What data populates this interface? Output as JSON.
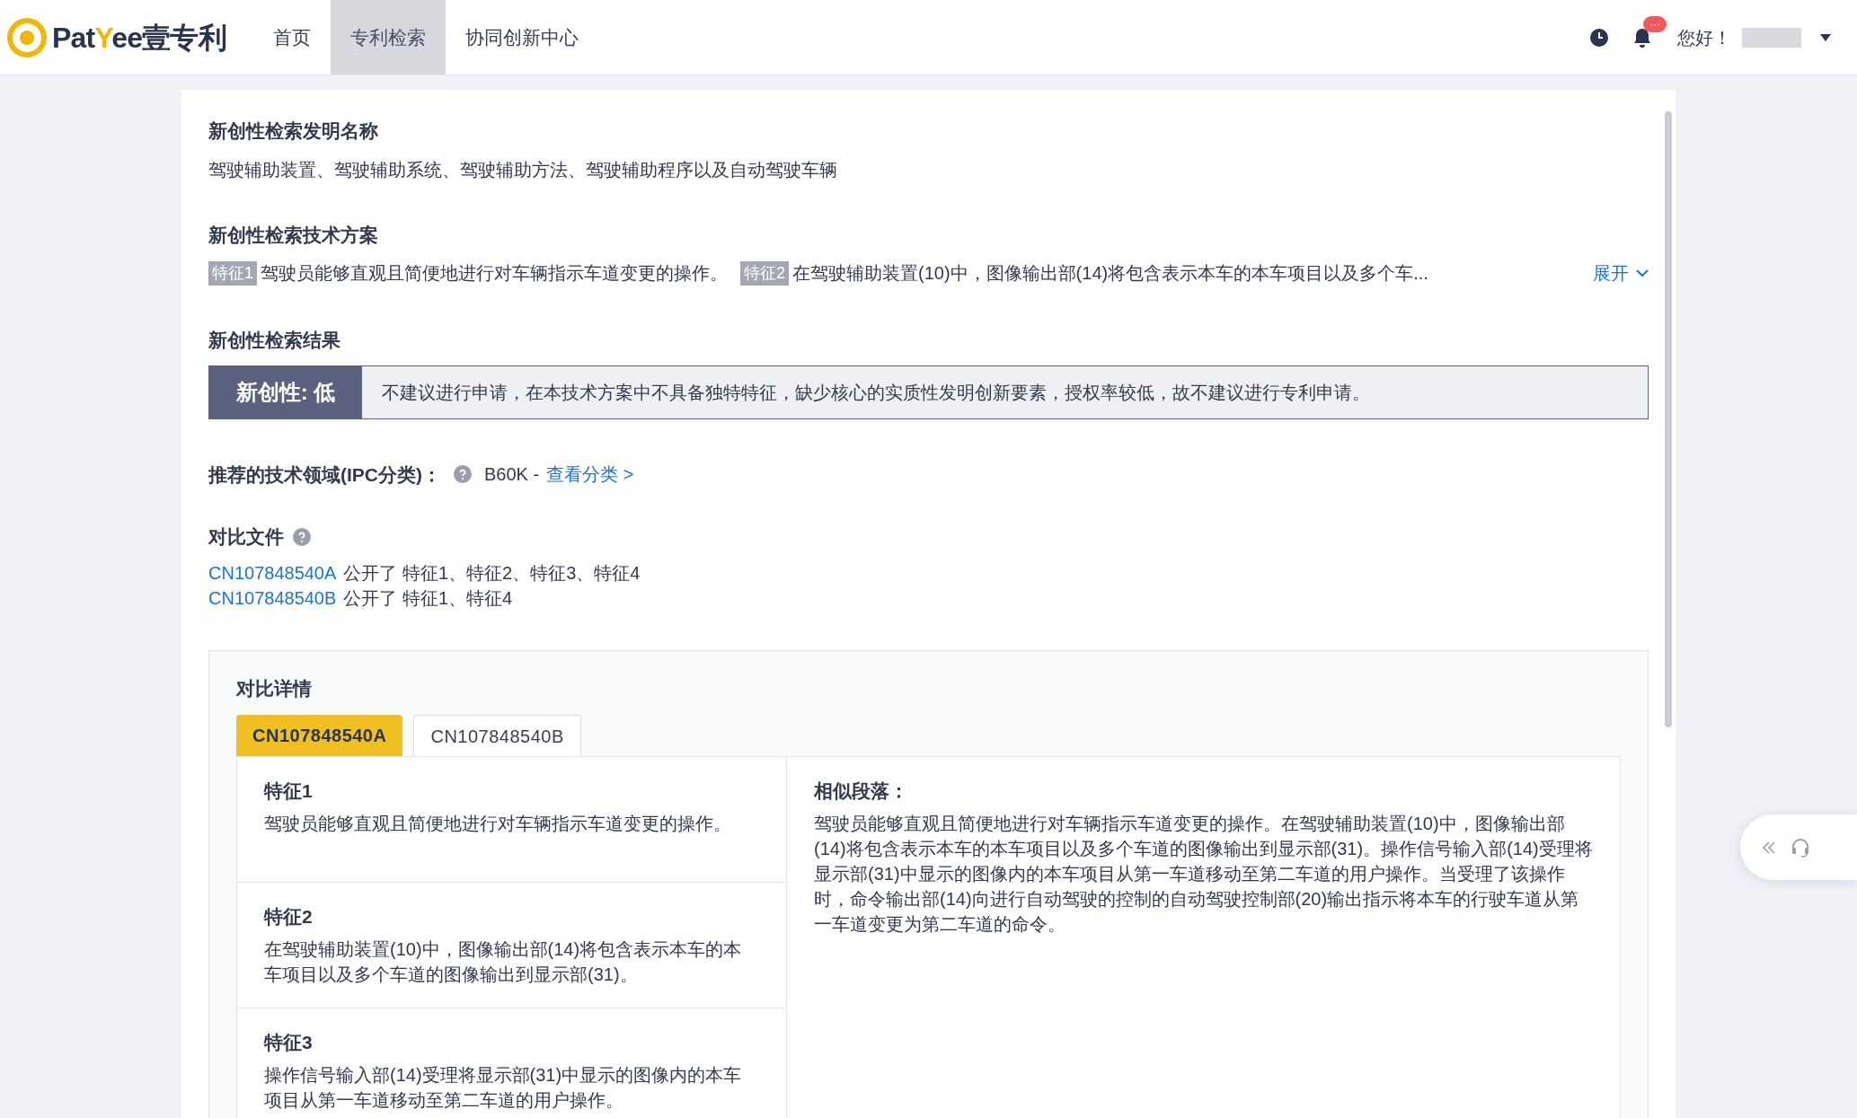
{
  "header": {
    "logo": [
      {
        "text": "Pat",
        "accent": false
      },
      {
        "text": "Y",
        "accent": true
      },
      {
        "text": "ee",
        "accent": false
      },
      {
        "text": "壹专利",
        "accent": false
      }
    ],
    "nav": [
      {
        "label": "首页",
        "selected": false
      },
      {
        "label": "专利检索",
        "selected": true
      },
      {
        "label": "协同创新中心",
        "selected": false
      }
    ],
    "notification_badge": "···",
    "greeting": "您好！"
  },
  "invention_name": {
    "title": "新创性检索发明名称",
    "text": "驾驶辅助装置、驾驶辅助系统、驾驶辅助方法、驾驶辅助程序以及自动驾驶车辆"
  },
  "technical_solution": {
    "title": "新创性检索技术方案",
    "features": [
      {
        "tag": "特征1",
        "text": "驾驶员能够直观且简便地进行对车辆指示车道变更的操作。"
      },
      {
        "tag": "特征2",
        "text": "在驾驶辅助装置(10)中，图像输出部(14)将包含表示本车的本车项目以及多个车..."
      }
    ],
    "expand_link": "展开"
  },
  "result": {
    "title": "新创性检索结果",
    "rating": "新创性: 低",
    "description": "不建议进行申请，在本技术方案中不具备独特特征，缺少核心的实质性发明创新要素，授权率较低，故不建议进行专利申请。"
  },
  "ipc": {
    "label": "推荐的技术领域(IPC分类)：",
    "code": "B60K -",
    "link": "查看分类 >"
  },
  "reference_documents": {
    "title": "对比文件",
    "items": [
      {
        "id": "CN107848540A",
        "text": "公开了 特征1、特征2、特征3、特征4"
      },
      {
        "id": "CN107848540B",
        "text": "公开了 特征1、特征4"
      }
    ]
  },
  "comparison": {
    "title": "对比详情",
    "tabs": [
      {
        "label": "CN107848540A",
        "selected": true
      },
      {
        "label": "CN107848540B",
        "selected": false
      }
    ],
    "features": [
      {
        "title": "特征1",
        "text": "驾驶员能够直观且简便地进行对车辆指示车道变更的操作。"
      },
      {
        "title": "特征2",
        "text": "在驾驶辅助装置(10)中，图像输出部(14)将包含表示本车的本车项目以及多个车道的图像输出到显示部(31)。"
      },
      {
        "title": "特征3",
        "text": "操作信号输入部(14)受理将显示部(31)中显示的图像内的本车项目从第一车道移动至第二车道的用户操作。"
      }
    ],
    "similar_title": "相似段落：",
    "similar_text": "驾驶员能够直观且简便地进行对车辆指示车道变更的操作。在驾驶辅助装置(10)中，图像输出部(14)将包含表示本车的本车项目以及多个车道的图像输出到显示部(31)。操作信号输入部(14)受理将显示部(31)中显示的图像内的本车项目从第一车道移动至第二车道的用户操作。当受理了该操作时，命令输出部(14)向进行自动驾驶的控制的自动驾驶控制部(20)输出指示将本车的行驶车道从第一车道变更为第二车道的命令。"
  }
}
